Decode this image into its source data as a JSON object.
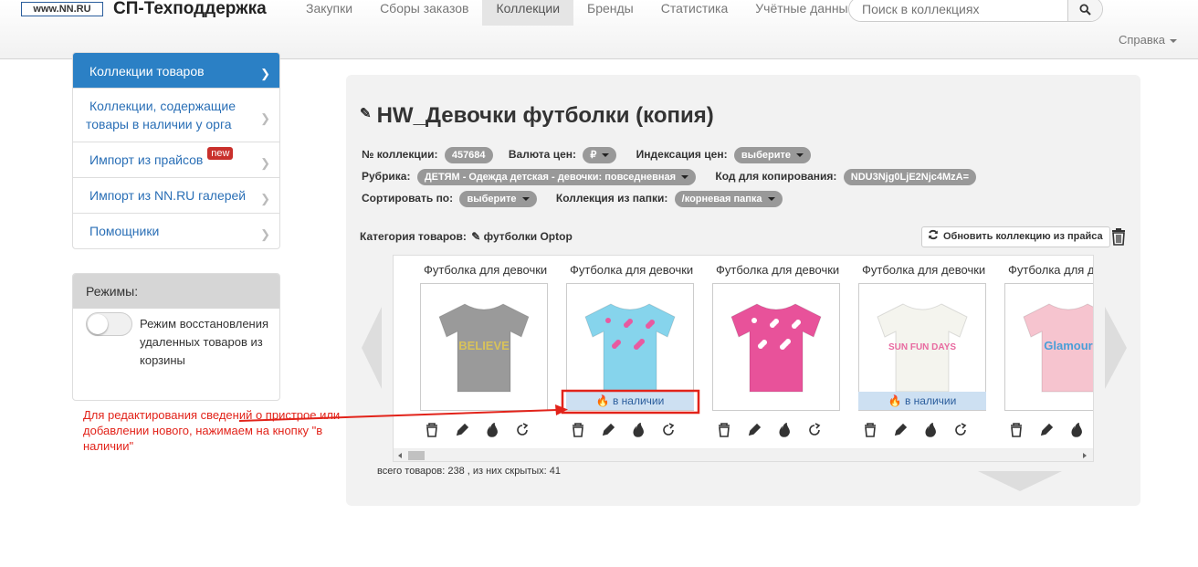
{
  "header": {
    "logo_text": "www.NN.RU",
    "brand": "СП-Техподдержка",
    "nav": [
      {
        "label": "Закупки"
      },
      {
        "label": "Сборы заказов"
      },
      {
        "label": "Коллекции"
      },
      {
        "label": "Бренды"
      },
      {
        "label": "Статистика"
      },
      {
        "label": "Учётные данные"
      }
    ],
    "active_nav": "Коллекции",
    "search_placeholder": "Поиск в коллекциях",
    "help_label": "Справка"
  },
  "sidebar": {
    "items": [
      {
        "label": "Коллекции товаров"
      },
      {
        "label": "Коллекции, содержащие товары в наличии у орга"
      },
      {
        "label": "Импорт из прайсов",
        "badge": "new"
      },
      {
        "label": "Импорт из NN.RU галерей"
      },
      {
        "label": "Помощники"
      }
    ],
    "modes_title": "Режимы:",
    "modes_toggle_label": "Режим восстановления удаленных товаров из корзины"
  },
  "annotation": {
    "text": "Для редактирования сведений о пристрое или добавлении нового, нажимаем на кнопку \"в наличии\"",
    "color": "#e2231a"
  },
  "collection": {
    "title": "HW_Девочки футболки (копия)",
    "number_label": "№ коллекции:",
    "number": "457684",
    "currency_label": "Валюта цен:",
    "currency": "₽",
    "indexing_label": "Индексация цен:",
    "indexing": "выберите",
    "rubric_label": "Рубрика:",
    "rubric": "ДЕТЯМ - Одежда детская - девочки: повседневная",
    "copy_code_label": "Код для копирования:",
    "copy_code": "NDU3Njg0LjE2Njc4MzA=",
    "sort_label": "Сортировать по:",
    "sort": "выберите",
    "folder_label": "Коллекция из папки:",
    "folder": "/корневая папка",
    "category_label": "Категория товаров:",
    "category": "футболки Optop",
    "refresh_label": "Обновить коллекцию из прайса",
    "products": [
      {
        "title": "Футболка для девочки",
        "in_stock": false,
        "color": "#9a9a9a",
        "print_text": "BELIEVE",
        "print_color": "#d8c25a"
      },
      {
        "title": "Футболка для девочки",
        "in_stock": true,
        "color": "#86d4ec",
        "print_text": "",
        "print_color": "#e85aa0"
      },
      {
        "title": "Футболка для девочки",
        "in_stock": false,
        "color": "#e8529a",
        "print_text": "",
        "print_color": "#ffffff"
      },
      {
        "title": "Футболка для девочки",
        "in_stock": true,
        "color": "#f4f4ee",
        "print_text": "SUN FUN DAYS",
        "print_color": "#e86aa0"
      },
      {
        "title": "Футболка для девочки",
        "in_stock": false,
        "color": "#f6c4cf",
        "print_text": "Glamour",
        "print_color": "#4a9fd8"
      }
    ],
    "stock_label": "в наличии",
    "total_text": "всего товаров: 238 , из них скрытых: 41"
  }
}
